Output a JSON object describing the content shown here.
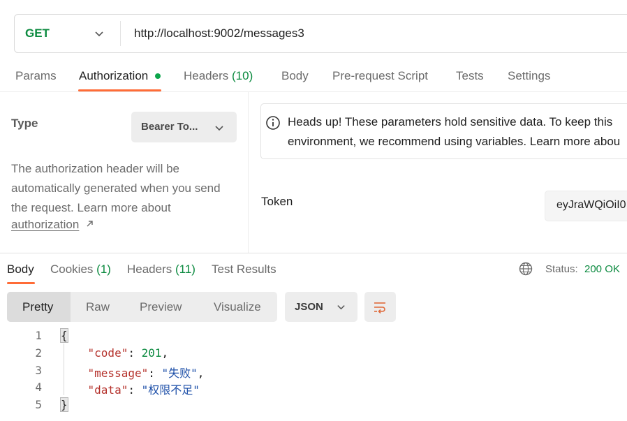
{
  "request": {
    "method": "GET",
    "url": "http://localhost:9002/messages3",
    "tabs": [
      {
        "label": "Params"
      },
      {
        "label": "Authorization"
      },
      {
        "label": "Headers",
        "count": "(10)"
      },
      {
        "label": "Body"
      },
      {
        "label": "Pre-request Script"
      },
      {
        "label": "Tests"
      },
      {
        "label": "Settings"
      }
    ]
  },
  "auth": {
    "type_label": "Type",
    "type_value": "Bearer To...",
    "description_lines": [
      "The authorization header will be",
      "automatically generated when you send",
      "the request. Learn more about"
    ],
    "link": "authorization",
    "info_lines": [
      "Heads up! These parameters hold sensitive data. To keep this",
      "environment, we recommend using variables. Learn more abou"
    ],
    "token_label": "Token",
    "token_value": "eyJraWQiOiI0"
  },
  "response": {
    "tabs": [
      {
        "label": "Body"
      },
      {
        "label": "Cookies",
        "count": "(1)"
      },
      {
        "label": "Headers",
        "count": "(11)"
      },
      {
        "label": "Test Results"
      }
    ],
    "status_label": "Status:",
    "status_value": "200 OK",
    "views": [
      "Pretty",
      "Raw",
      "Preview",
      "Visualize"
    ],
    "format": "JSON",
    "line_numbers": [
      "1",
      "2",
      "3",
      "4",
      "5"
    ],
    "json": {
      "open": "{",
      "close": "}",
      "keys": [
        "\"code\"",
        "\"message\"",
        "\"data\""
      ],
      "values": [
        "201",
        "\"失败\"",
        "\"权限不足\""
      ]
    }
  },
  "colors": {
    "accent": "#ff6c37",
    "success": "#0b8a3f",
    "json_key": "#b5322c",
    "json_string": "#1d4fa8"
  }
}
